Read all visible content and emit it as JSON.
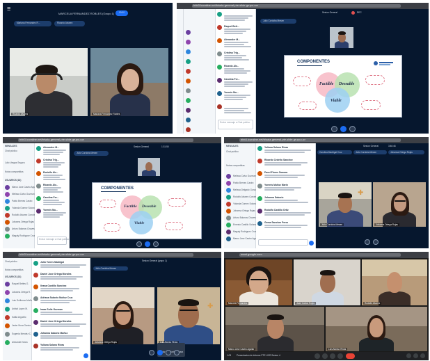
{
  "panel1": {
    "session_title": "MARCELA FERNANDEZ ROBLES (Grupo 1)",
    "rec_label": "00:00",
    "chip1": "Mariana Fernandez R...",
    "chip2": "Ricardo Alvarez",
    "cam1_name": "Ricardo Alvarez",
    "cam2_name": "Mariana Fernandez Robles"
  },
  "panel2": {
    "url": "bbb3.lcuraline.net/b/sala-general-pte-slide-grupo-ucr",
    "session_title": "Sesion General",
    "rec_label": "REC",
    "presenter_chip": "Julio Cordoba Mesen",
    "slide_title": "COMPONENTES",
    "c1": "Factible",
    "c2": "Deseable",
    "c3": "Viable",
    "chat_placeholder": "Enviar mensaje a Chat publico",
    "chat_names": [
      "",
      "Raquel Bett...",
      "Alexander M...",
      "Cristina Trig...",
      "Ricardo Alv...",
      "Carolina Fer...",
      "Yorenis Mu...",
      ""
    ],
    "users": [
      "",
      "",
      "",
      "",
      "",
      "",
      "",
      "",
      "",
      "",
      ""
    ]
  },
  "panel3": {
    "url": "bbb3.lcuraline.net/b/sala-general-pte-slide-grupo-ucr",
    "users_header": "MENSAJES",
    "chat_public": "Chat publico",
    "notes": "Notas compartidas",
    "users_section": "USUARIOS (18)",
    "self_user": "Julio Vargas Segura",
    "session_title": "Sesion General",
    "rec_label": "1:31:50",
    "presenter_chip": "Julio Cordoba Mesen",
    "slide_title": "COMPONENTES",
    "c1": "Factible",
    "c2": "Deseable",
    "c3": "Viable",
    "users": [
      "Marco Jose Castro Aguilar",
      "Melissa Calvo Guzman",
      "Pablo Brenes Castro",
      "Yolanda Gomez Solano",
      "Rodolfo Alvarez Corrales",
      "Johanna Ortega Rojas",
      "Arturo Bolanos Chaves",
      "Magaly Rodriguez Cruz"
    ],
    "chat_names": [
      "Alexander M...",
      "Cristina Trig...",
      "Rodolfo Alv...",
      "Ricardo Alv...",
      "Carolina Fer...",
      "Yorenis Mu..."
    ],
    "chat_placeholder": "Enviar mensaje a Chat publico"
  },
  "panel4": {
    "url": "bbb3.lcuraline.net/b/sala-general-pte-slide-grupo-ucr",
    "users_header": "MENSAJES",
    "chat_public": "Chat publico",
    "notes": "Notas compartidas",
    "session_title": "Sesion General",
    "rec_label": "3:46:46",
    "chip1": "Carolina Madrigal Cruz",
    "chip2": "Julio Cordoba Mesen",
    "chip3": "Johanna Ortega Rojas",
    "users": [
      "Melissa Calvo Guzman",
      "Pablo Brenes Castro",
      "Melissa Delgado Gonzalez",
      "Rodolfo Alvarez Corrales",
      "Yolanda Gomez Solano",
      "Johanna Ortega Rojas",
      "Arturo Bolanos Chaves",
      "Ernesto Castillo Solano",
      "Magaly Rodriguez Cruz",
      "Marco Jose Castro Aguilar"
    ],
    "chat_names": [
      "Yuliana Solano Rivas",
      "Ricardo Cedeño Sanchez",
      "Pavel Flores Zamora",
      "Yorenis Muñoz Marin",
      "Johanna Saborio",
      "Rodolfo Castillo Ortiz",
      "Gema Sanchez Perez"
    ],
    "cam1_name": "Julio Cordoba Mesen",
    "cam2_name": "Johanna Ortega Rojas"
  },
  "panel5": {
    "url": "bbb3.lcuraline.net/b/sala-general-pte-slide-grupo-ucr",
    "chat_public": "Chat publico",
    "notes": "Notas compartidas",
    "users_section": "USUARIOS (18)",
    "session_title": "Sesion General (grupo 1)",
    "presenter_chip": "Julio Cordoba Mesen",
    "users": [
      "Raquel Bettes G.",
      "Johanna Ortega R.",
      "Luis Guillermo Muñoz",
      "Anibal Lopez M.",
      "Kattia Arguello",
      "Javier Mora Garcia",
      "Eugenia Mendez C.",
      "Alexander Mora"
    ],
    "chat_names": [
      "Julio Torres Madrigal",
      "Daniel Jose Ortega Morales",
      "Ileana Castillo Sanchez",
      "Adriana Saborio Muñoz Cruz",
      "Isaac Solis Guzman",
      "Daniel Jose Ortega Morales",
      "Johanna Saborio Muñoz",
      "Yuliana Solano Rivas"
    ],
    "cam1_name": "Johanna Ortega Rojas",
    "cam2_name": "Luis Alonso Rivas",
    "tooltip": "Iniciar compartir camara"
  },
  "panel6": {
    "url": "meet.google.com",
    "bottom_text": "Presentacion de informe PTE UCR Sesion 4",
    "time": "1:03",
    "names": [
      "Marcela Fernandez",
      "Juan Carlos Rojas",
      "Rodolfo Alvarez",
      "Marco Jose Castro Aguilar",
      "Luis Alonso Rivas"
    ]
  },
  "colors": {
    "bbb_navy": "#06172e",
    "bbb_blue": "#1b6cf2",
    "slide_title": "#13325c"
  }
}
